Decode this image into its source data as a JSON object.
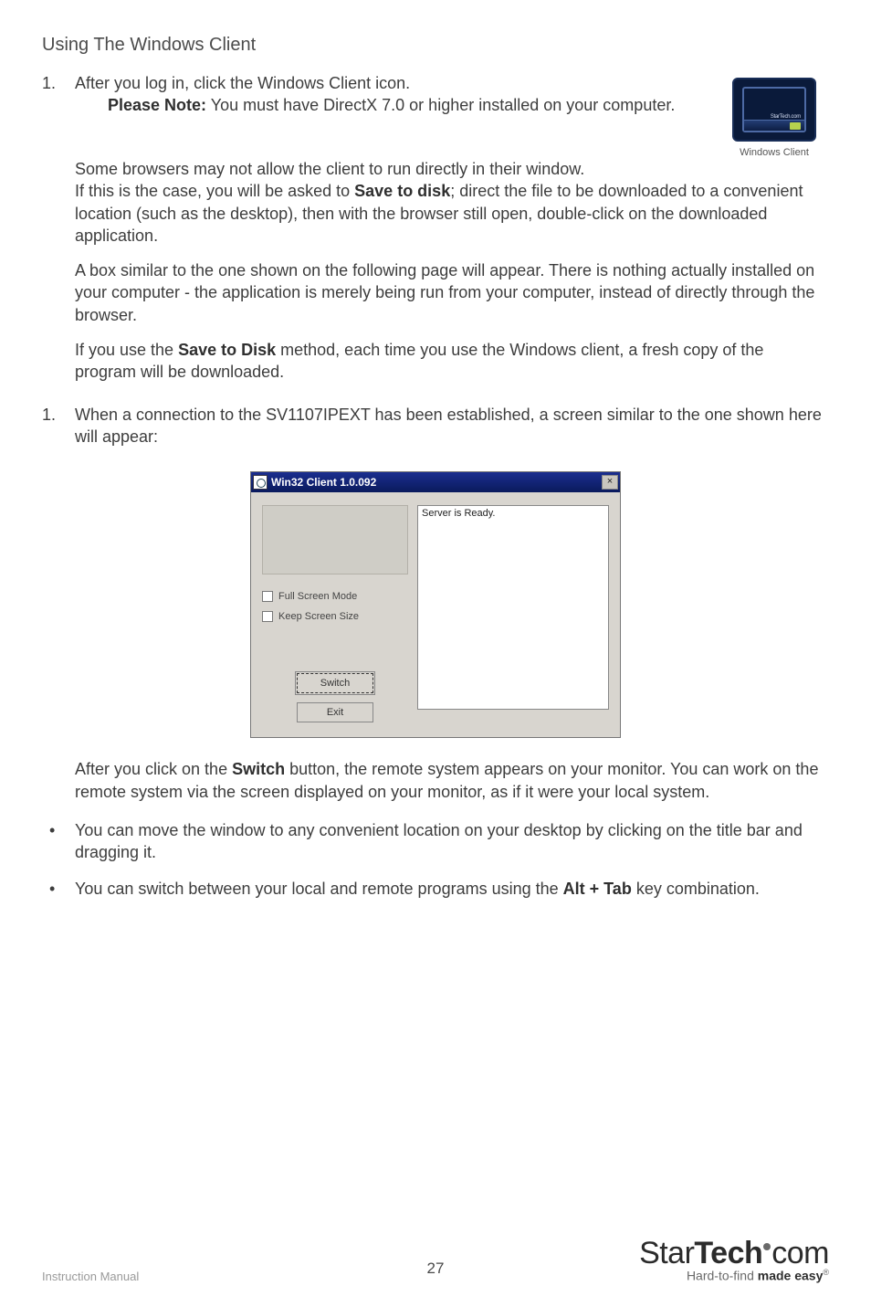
{
  "heading": "Using The Windows Client",
  "step1": {
    "l1": "After you log in, click the Windows Client icon.",
    "note_label": "Please Note:",
    "note_text": " You must have DirectX 7.0 or higher installed on your computer.",
    "p2a": "Some browsers may not allow the client to run directly in their window.",
    "p2b_pre": "If this is the case, you will be asked to ",
    "p2b_bold": "Save to disk",
    "p2b_post": "; direct the file to be downloaded to a convenient location (such as the desktop), then with the browser still open, double-click on the downloaded application.",
    "p3": "A box similar to the one shown on the following page will appear. There is nothing actually installed on your computer - the application is merely being run from your computer, instead of directly through the browser.",
    "p4_pre": "If you use the ",
    "p4_bold": "Save to   Disk",
    "p4_post": " method, each time you use the Windows client, a fresh copy of the program will be downloaded."
  },
  "step2": {
    "text": "When a connection to the SV1107IPEXT has been established, a screen similar to the one shown here will appear:"
  },
  "dialog": {
    "title": "Win32 Client 1.0.092",
    "close": "×",
    "check1": "Full Screen Mode",
    "check2": "Keep Screen Size",
    "btn_switch": "Switch",
    "btn_exit": "Exit",
    "status": "Server is Ready."
  },
  "after_dialog": {
    "pre": "After you click on the ",
    "bold": "Switch",
    "post": " button, the remote system appears on your monitor. You can work on the remote system via the screen displayed on your monitor, as if it were your local system."
  },
  "bullets": {
    "b1": "You can move the window to any convenient location on your desktop by clicking on the title bar and dragging it.",
    "b2_pre": "You can switch between your local and remote programs using the  ",
    "b2_bold": "Alt + Tab",
    "b2_post": " key combination."
  },
  "icon_caption": "Windows Client",
  "icon_inner_text": "StarTech.com",
  "footer": {
    "left": "Instruction Manual",
    "page": "27",
    "logo_main_a": "Star",
    "logo_main_b": "Tech",
    "logo_main_c": "com",
    "logo_sub_pre": "Hard-to-find ",
    "logo_sub_bold": "made easy",
    "logo_sub_r": "®"
  }
}
